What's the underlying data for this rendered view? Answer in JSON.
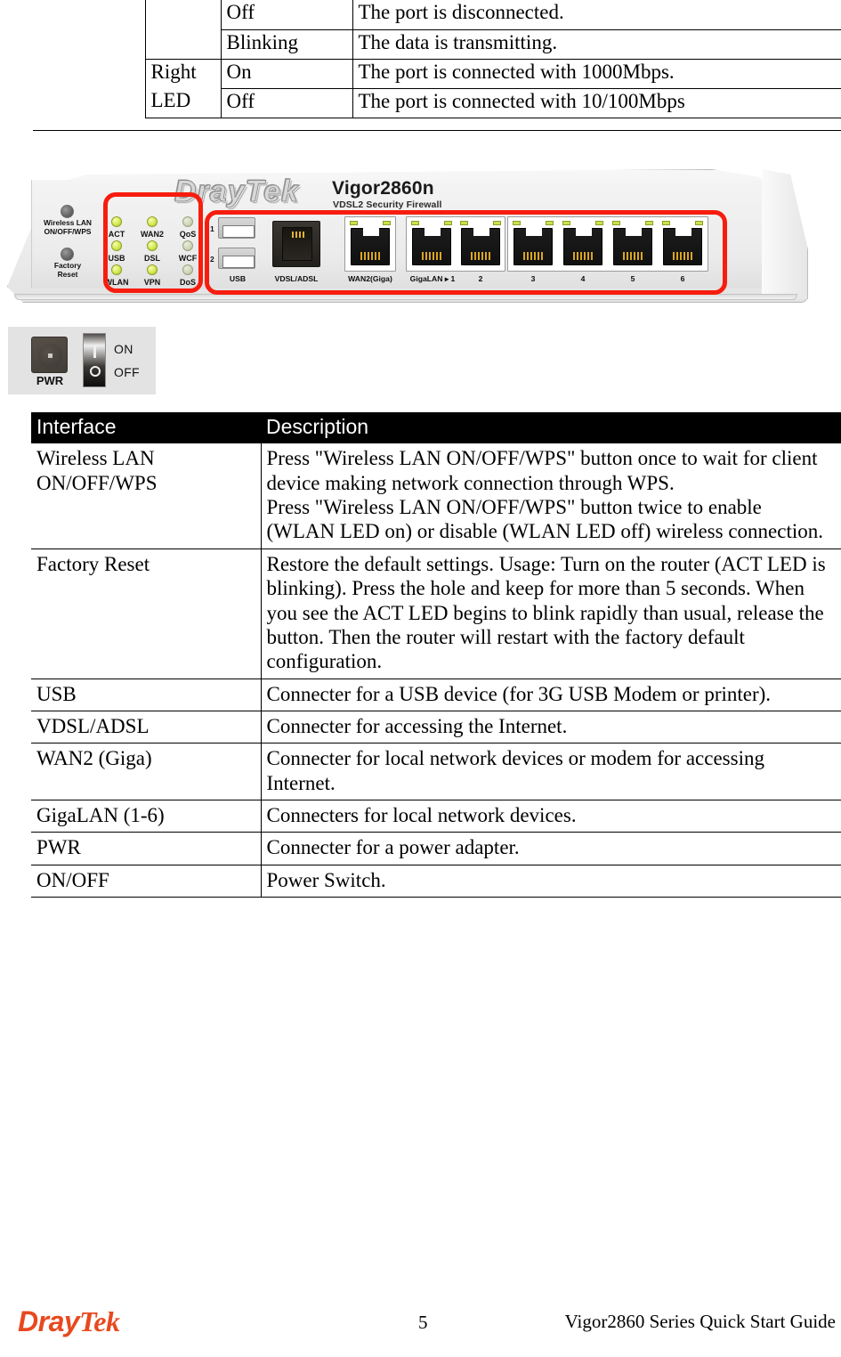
{
  "led_table": {
    "rows": [
      {
        "group": "",
        "state": "Off",
        "description": "The port is disconnected."
      },
      {
        "group": "",
        "state": "Blinking",
        "description": "The data is transmitting."
      },
      {
        "group": "Right",
        "state": "On",
        "description": "The port is connected with 1000Mbps."
      },
      {
        "group": "LED",
        "state": "Off",
        "description": "The port is connected with 10/100Mbps"
      }
    ]
  },
  "router_figure": {
    "brand": "DrayTek",
    "model": "Vigor2860n",
    "model_subtitle": "VDSL2 Security Firewall",
    "buttons": [
      {
        "label_line1": "Wireless LAN",
        "label_line2": "ON/OFF/WPS"
      },
      {
        "label_line1": "Factory",
        "label_line2": "Reset"
      }
    ],
    "leds": [
      "ACT",
      "WAN2",
      "QoS",
      "USB",
      "DSL",
      "WCF",
      "WLAN",
      "VPN",
      "DoS"
    ],
    "usb_numbers": [
      "1",
      "2"
    ],
    "port_labels": {
      "usb": "USB",
      "dsl": "VDSL/ADSL",
      "wan2": "WAN2(Giga)",
      "lan1": "GigaLAN ▸ 1",
      "lan2": "2",
      "lan3": "3",
      "lan4": "4",
      "lan5": "5",
      "lan6": "6"
    },
    "highlight_color": "#f71d0e"
  },
  "power_figure": {
    "pwr_label": "PWR",
    "switch_on": "ON",
    "switch_off": "OFF"
  },
  "iface_table": {
    "headers": {
      "interface": "Interface",
      "description": "Description"
    },
    "rows": [
      {
        "interface": "Wireless LAN ON/OFF/WPS",
        "description": "Press \"Wireless LAN ON/OFF/WPS\" button once to wait for client device making network connection through WPS.\nPress \"Wireless LAN ON/OFF/WPS\" button twice to enable (WLAN LED on) or disable (WLAN LED off) wireless connection."
      },
      {
        "interface": "Factory Reset",
        "description": "Restore the default settings. Usage: Turn on the router (ACT LED is blinking). Press the hole and keep for more than 5 seconds. When you see the ACT LED begins to blink rapidly than usual, release the button. Then the router will restart with the factory default configuration."
      },
      {
        "interface": "USB",
        "description": "Connecter for a USB device (for 3G USB Modem or printer)."
      },
      {
        "interface": "VDSL/ADSL",
        "description": "Connecter for accessing the Internet."
      },
      {
        "interface": "WAN2 (Giga)",
        "description": "Connecter for local network devices or modem for accessing Internet."
      },
      {
        "interface": "GigaLAN (1-6)",
        "description": "Connecters for local network devices."
      },
      {
        "interface": "PWR",
        "description": "Connecter for a power adapter."
      },
      {
        "interface": "ON/OFF",
        "description": "Power Switch."
      }
    ]
  },
  "footer": {
    "logo_dray": "Dray",
    "logo_tek": "Tek",
    "page_number": "5",
    "guide_title": "Vigor2860 Series Quick Start Guide"
  }
}
